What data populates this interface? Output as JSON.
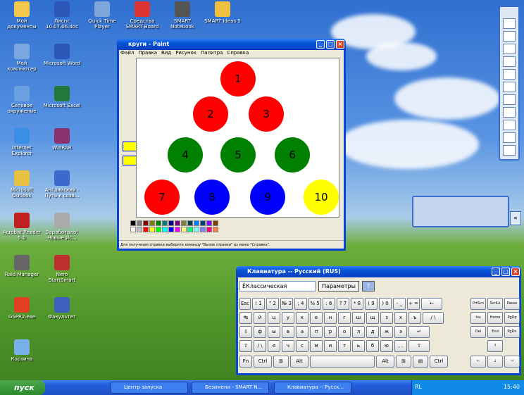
{
  "desktop": {
    "icons": [
      {
        "label": "Мой документы",
        "color": "#f2c94c"
      },
      {
        "label": "Лиспс 10.07.06.doc",
        "color": "#2b58b8"
      },
      {
        "label": "Quick Time Player",
        "color": "#7fa6d8"
      },
      {
        "label": "Средства SMART Board",
        "color": "#d33"
      },
      {
        "label": "SMART Notebook",
        "color": "#555"
      },
      {
        "label": "SMART Ideas 5",
        "color": "#f0c040"
      },
      {
        "label": "Мой компьютер",
        "color": "#7aa7e0"
      },
      {
        "label": "Microsoft Word",
        "color": "#2b58b8"
      },
      {
        "label": "Сетевое окружение",
        "color": "#6aa0e0"
      },
      {
        "label": "Microsoft Excel",
        "color": "#1f7a3a"
      },
      {
        "label": "Internet Explorer",
        "color": "#3a8ee6"
      },
      {
        "label": "WinRAR",
        "color": "#8a3070"
      },
      {
        "label": "Microsoft Outlook",
        "color": "#e6c040"
      },
      {
        "label": "Английский - Путь к созв...",
        "color": "#3a6ad0"
      },
      {
        "label": "Acrobat Reader 5.0",
        "color": "#c02020"
      },
      {
        "label": "Заработало! Новые Ис...",
        "color": "#aaa"
      },
      {
        "label": "Raid Manager",
        "color": "#666"
      },
      {
        "label": "Nero StartSmart",
        "color": "#c03030"
      },
      {
        "label": "GSPR2.exe",
        "color": "#e04020"
      },
      {
        "label": "Факультет",
        "color": "#4060c0"
      },
      {
        "label": "Корзина",
        "color": "#7ab0e8"
      }
    ]
  },
  "paint": {
    "title": "круги - Paint",
    "menu": [
      "Файл",
      "Правка",
      "Вид",
      "Рисунок",
      "Палитра",
      "Справка"
    ],
    "status": "Для получения справки выберите команду \"Вызов справки\" из меню \"Справка\".",
    "balls": [
      {
        "n": "1",
        "color": "#ff0000"
      },
      {
        "n": "2",
        "color": "#ff0000"
      },
      {
        "n": "3",
        "color": "#ff0000"
      },
      {
        "n": "4",
        "color": "#008000"
      },
      {
        "n": "5",
        "color": "#008000"
      },
      {
        "n": "6",
        "color": "#008000"
      },
      {
        "n": "7",
        "color": "#ff0000"
      },
      {
        "n": "8",
        "color": "#0000ff"
      },
      {
        "n": "9",
        "color": "#0000ff"
      },
      {
        "n": "10",
        "color": "#ffff00"
      }
    ],
    "palette": [
      "#000",
      "#808080",
      "#800000",
      "#808000",
      "#008000",
      "#008080",
      "#000080",
      "#800080",
      "#808040",
      "#004040",
      "#0080ff",
      "#004080",
      "#8000ff",
      "#804000",
      "#fff",
      "#c0c0c0",
      "#f00",
      "#ff0",
      "#0f0",
      "#0ff",
      "#00f",
      "#f0f",
      "#ffff80",
      "#00ff80",
      "#80ffff",
      "#8080ff",
      "#ff0080",
      "#ff8040"
    ]
  },
  "keyboard": {
    "title": "Клавиатура -- Русский (RUS)",
    "layout_value": "ЁКлассическая",
    "params_label": "Параметры",
    "help_label": "?",
    "rows": [
      [
        "Esc",
        "! 1",
        "\" 2",
        "№ 3",
        "; 4",
        "% 5",
        ": 6",
        "? 7",
        "* 8",
        "( 9",
        ") 0",
        "- _",
        "+ =",
        "←"
      ],
      [
        "↹",
        "й",
        "ц",
        "у",
        "к",
        "е",
        "н",
        "г",
        "ш",
        "щ",
        "з",
        "х",
        "ъ",
        "/ \\"
      ],
      [
        "⇩",
        "ф",
        "ы",
        "в",
        "а",
        "п",
        "р",
        "о",
        "л",
        "д",
        "ж",
        "э",
        "↵"
      ],
      [
        "⇧",
        "/ \\",
        "я",
        "ч",
        "с",
        "м",
        "и",
        "т",
        "ь",
        "б",
        "ю",
        ", .",
        "⇧"
      ],
      [
        "Fn",
        "Ctrl",
        "⊞",
        "Alt",
        "",
        "Alt",
        "⊞",
        "▤",
        "Ctrl"
      ]
    ],
    "side": [
      "PrtScn",
      "ScrlLk",
      "Pause",
      "Ins",
      "Home",
      "PgUp",
      "Del",
      "End",
      "PgDn",
      "↑",
      "←",
      "↓",
      "→"
    ]
  },
  "taskbar": {
    "start": "пуск",
    "items": [
      "Центр запуска",
      "Безимени - SMART N...",
      "Клавиатура -- Русск..."
    ],
    "lang": "RL",
    "clock": "15:40"
  }
}
